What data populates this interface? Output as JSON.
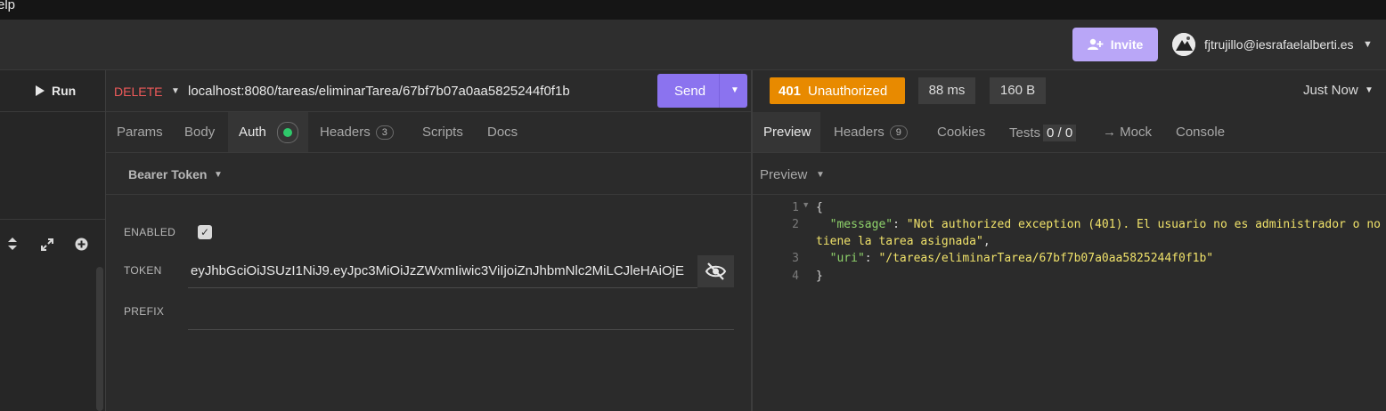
{
  "menubar": {
    "help_label": "elp"
  },
  "header": {
    "invite_label": "Invite",
    "user_email": "fjtrujillo@iesrafaelalberti.es"
  },
  "sidebar": {
    "run_label": "Run"
  },
  "request": {
    "method": "DELETE",
    "url": "localhost:8080/tareas/eliminarTarea/67bf7b07a0aa5825244f0f1b",
    "send_label": "Send",
    "tabs": {
      "params": "Params",
      "body": "Body",
      "auth": "Auth",
      "headers": "Headers",
      "headers_count": "3",
      "scripts": "Scripts",
      "docs": "Docs"
    },
    "auth": {
      "type": "Bearer Token",
      "enabled_label": "ENABLED",
      "enabled": true,
      "token_label": "TOKEN",
      "token_value": "eyJhbGciOiJSUzI1NiJ9.eyJpc3MiOiJzZWxmIiwic3ViIjoiZnJhbmNlc2MiLCJleHAiOjE",
      "prefix_label": "PREFIX",
      "prefix_value": ""
    }
  },
  "response": {
    "status_code": "401",
    "status_text": "Unauthorized",
    "time": "88 ms",
    "size": "160 B",
    "timestamp": "Just Now",
    "tabs": {
      "preview": "Preview",
      "headers": "Headers",
      "headers_count": "9",
      "cookies": "Cookies",
      "tests": "Tests",
      "tests_count": "0 / 0",
      "mock": "→ Mock",
      "console": "Console"
    },
    "preview_mode": "Preview",
    "body": {
      "line_numbers": [
        "1",
        "2",
        "3",
        "4"
      ],
      "open_brace": "{",
      "message_key": "\"message\"",
      "message_value_1": "\"Not authorized exception (401). El usuario no es administrador o no",
      "message_value_2": "tiene la tarea asignada\"",
      "uri_key": "\"uri\"",
      "uri_value": "\"/tareas/eliminarTarea/67bf7b07a0aa5825244f0f1b\"",
      "close_brace": "}"
    }
  },
  "colors": {
    "accent_purple": "#8b73ef",
    "status_orange": "#e88a00",
    "method_red": "#ef5a5a",
    "enabled_green": "#2fc96b"
  }
}
